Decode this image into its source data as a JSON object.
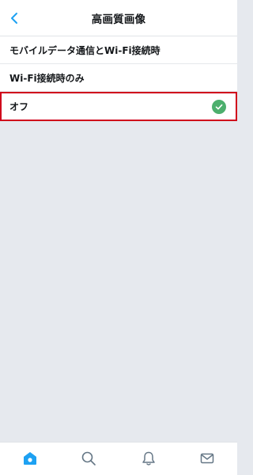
{
  "header": {
    "title": "高画質画像",
    "back_icon": "chevron-left-icon"
  },
  "options": [
    {
      "label": "モバイルデータ通信とWi-Fi接続時",
      "selected": false
    },
    {
      "label": "Wi-Fi接続時のみ",
      "selected": false
    },
    {
      "label": "オフ",
      "selected": true
    }
  ],
  "tabbar": {
    "items": [
      {
        "icon": "home-icon",
        "active": true
      },
      {
        "icon": "search-icon",
        "active": false
      },
      {
        "icon": "bell-icon",
        "active": false
      },
      {
        "icon": "mail-icon",
        "active": false
      }
    ]
  },
  "colors": {
    "accent": "#1da1f2",
    "check": "#4caf6d",
    "highlight_border": "#d0021b",
    "background": "#e6e9ee"
  }
}
